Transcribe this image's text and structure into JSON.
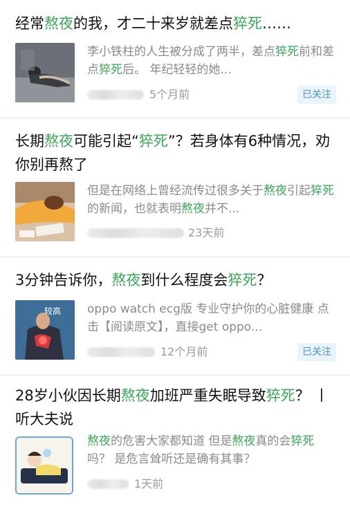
{
  "articles": [
    {
      "title": [
        {
          "t": "经常"
        },
        {
          "t": "熬夜",
          "hl": true
        },
        {
          "t": "的我，才二十来岁就差点"
        },
        {
          "t": "猝死",
          "hl": true
        },
        {
          "t": "……"
        }
      ],
      "snippet": [
        {
          "t": "李小铁柱的人生被分成了两半，差点"
        },
        {
          "t": "猝死",
          "hl": true
        },
        {
          "t": "前和差点"
        },
        {
          "t": "猝死",
          "hl": true
        },
        {
          "t": "后。 年纪轻轻的她..."
        }
      ],
      "time": "5个月前",
      "follow_label": "已关注",
      "thumb_icon": "sleeping-woman-on-floor-thumbnail"
    },
    {
      "title": [
        {
          "t": "长期"
        },
        {
          "t": "熬夜",
          "hl": true
        },
        {
          "t": "可能引起“"
        },
        {
          "t": "猝死",
          "hl": true
        },
        {
          "t": "”？若身体有6种情况，劝你别再熬了"
        }
      ],
      "snippet": [
        {
          "t": "但是在网络上曾经流传过很多关于"
        },
        {
          "t": "熬夜",
          "hl": true
        },
        {
          "t": "引起"
        },
        {
          "t": "猝死",
          "hl": true
        },
        {
          "t": "的新闻，也就表明"
        },
        {
          "t": "熬夜",
          "hl": true
        },
        {
          "t": "并不..."
        }
      ],
      "time": "23天前",
      "thumb_icon": "woman-asleep-on-desk-thumbnail"
    },
    {
      "title": [
        {
          "t": "3分钟告诉你，"
        },
        {
          "t": "熬夜",
          "hl": true
        },
        {
          "t": "到什么程度会"
        },
        {
          "t": "猝死",
          "hl": true
        },
        {
          "t": "？"
        }
      ],
      "snippet": [
        {
          "t": "oppo watch ecg版 专业守护你的心脏健康 点击【阅读原文】，直接get oppo..."
        }
      ],
      "time": "12个月前",
      "follow_label": "已关注",
      "thumb_icon": "chest-pain-illustration-thumbnail",
      "thumb_text": "较高"
    },
    {
      "title": [
        {
          "t": "28岁小伙因长期"
        },
        {
          "t": "熬夜",
          "hl": true
        },
        {
          "t": "加班严重失眠导致"
        },
        {
          "t": "猝死",
          "hl": true
        },
        {
          "t": "？ 丨听大夫说"
        }
      ],
      "snippet": [
        {
          "t": "熬夜",
          "hl": true
        },
        {
          "t": "的危害大家都知道 但是"
        },
        {
          "t": "熬夜",
          "hl": true
        },
        {
          "t": "真的会"
        },
        {
          "t": "猝死",
          "hl": true
        },
        {
          "t": "吗？ 是危言耸听还是确有其事？"
        }
      ],
      "time": "1天前",
      "thumb_icon": "cartoon-person-sleeping-thumbnail"
    }
  ]
}
